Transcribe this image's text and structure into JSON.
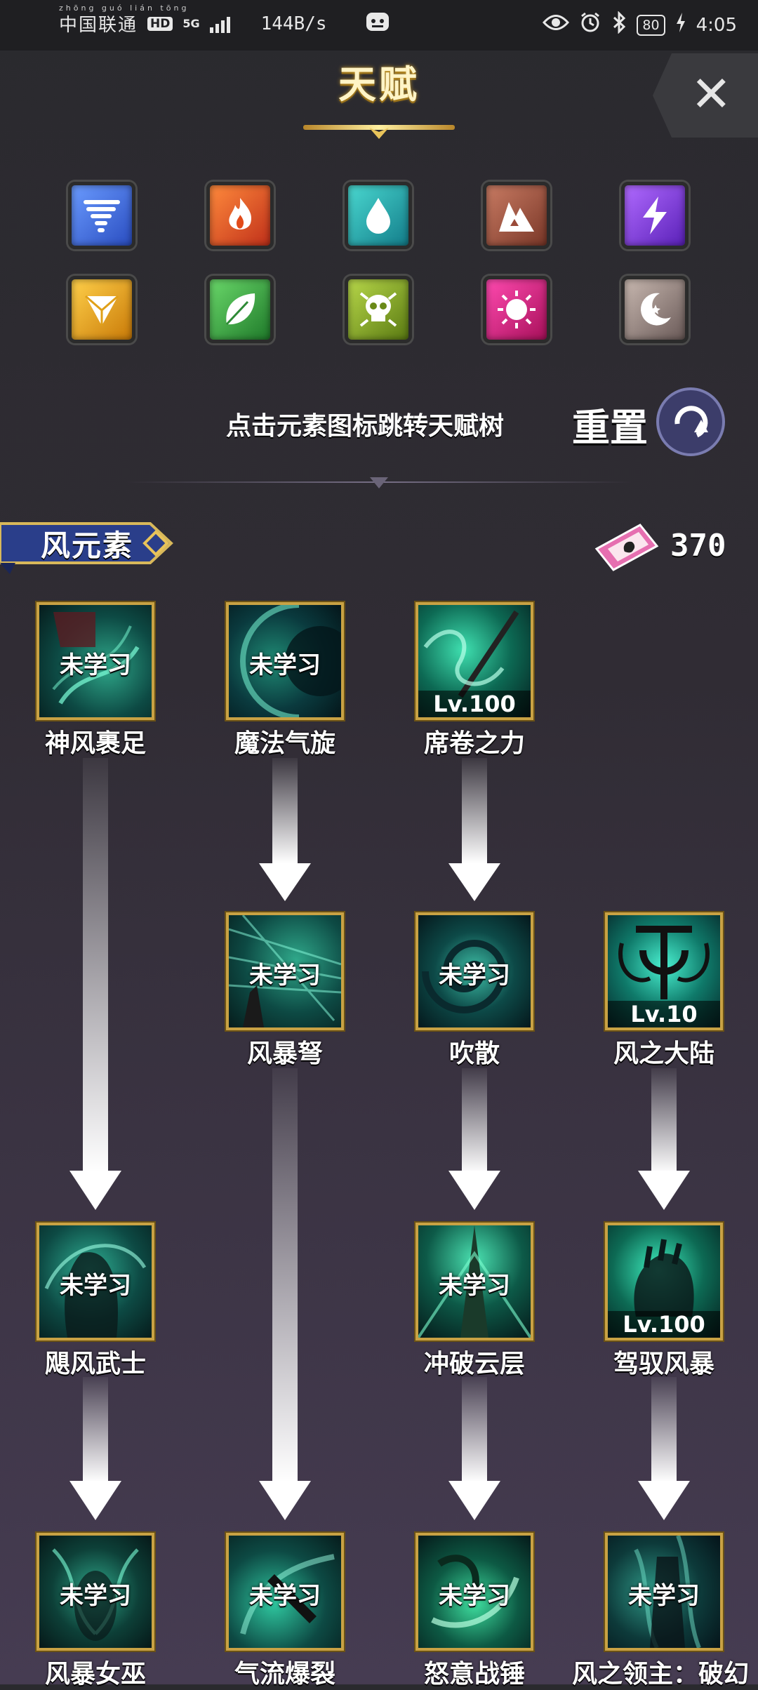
{
  "status_bar": {
    "carrier_pinyin": "zhōng guó lián tōng",
    "carrier": "中国联通",
    "hd": "HD",
    "network": "5G",
    "net_speed": "144B/s",
    "battery": "80",
    "time": "4:05"
  },
  "header": {
    "title": "天赋",
    "close_label": "✕"
  },
  "elements": [
    {
      "id": "wind",
      "icon": "tornado-icon",
      "color": "#3f6fe0"
    },
    {
      "id": "fire",
      "icon": "flame-icon",
      "color": "#e0551f"
    },
    {
      "id": "water",
      "icon": "droplet-icon",
      "color": "#1fb8b8"
    },
    {
      "id": "earth",
      "icon": "rock-icon",
      "color": "#a85a45"
    },
    {
      "id": "thunder",
      "icon": "lightning-icon",
      "color": "#8a3fe0"
    },
    {
      "id": "light",
      "icon": "prism-icon",
      "color": "#e8a518"
    },
    {
      "id": "nature",
      "icon": "leaf-icon",
      "color": "#3fa83f"
    },
    {
      "id": "poison",
      "icon": "skull-icon",
      "color": "#8fb82a"
    },
    {
      "id": "holy",
      "icon": "sun-icon",
      "color": "#d8207f"
    },
    {
      "id": "dark",
      "icon": "moon-icon",
      "color": "#9a8a84"
    }
  ],
  "hint_text": "点击元素图标跳转天赋树",
  "reset_label": "重置",
  "current_element": "风元素",
  "currency": {
    "value": "370"
  },
  "talents": [
    {
      "id": "t1",
      "name": "神风裹足",
      "status": "未学习",
      "level": ""
    },
    {
      "id": "t2",
      "name": "魔法气旋",
      "status": "未学习",
      "level": ""
    },
    {
      "id": "t3",
      "name": "席卷之力",
      "status": "",
      "level": "Lv.100"
    },
    {
      "id": "t4",
      "name": "风暴弩",
      "status": "未学习",
      "level": ""
    },
    {
      "id": "t5",
      "name": "吹散",
      "status": "未学习",
      "level": ""
    },
    {
      "id": "t6",
      "name": "风之大陆",
      "status": "",
      "level": "Lv.10"
    },
    {
      "id": "t7",
      "name": "飓风武士",
      "status": "未学习",
      "level": ""
    },
    {
      "id": "t8",
      "name": "冲破云层",
      "status": "未学习",
      "level": ""
    },
    {
      "id": "t9",
      "name": "驾驭风暴",
      "status": "",
      "level": "Lv.100"
    },
    {
      "id": "t10",
      "name": "风暴女巫",
      "status": "未学习",
      "level": ""
    },
    {
      "id": "t11",
      "name": "气流爆裂",
      "status": "未学习",
      "level": ""
    },
    {
      "id": "t12",
      "name": "怒意战锤",
      "status": "未学习",
      "level": ""
    },
    {
      "id": "t13",
      "name": "风之领主：破幻",
      "status": "未学习",
      "level": ""
    }
  ]
}
